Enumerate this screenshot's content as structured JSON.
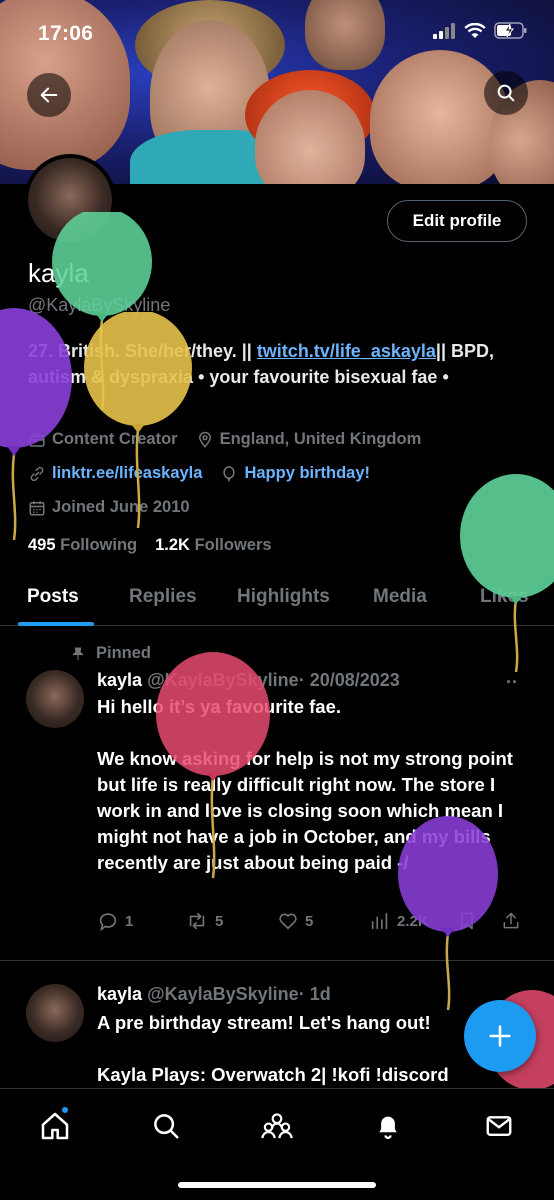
{
  "status": {
    "time": "17:06"
  },
  "profile": {
    "display_name": "kayla",
    "handle": "@KaylaBySkyline",
    "edit_label": "Edit profile",
    "bio_text": "27. British. She/her/they. || ",
    "bio_link": "twitch.tv/life_askayla",
    "bio_rest": "|| BPD, autism & dyspraxia • your favourite bisexual fae •",
    "category": "Content Creator",
    "location": "England, United Kingdom",
    "website": "linktr.ee/lifeaskayla",
    "birthday": "Happy birthday!",
    "joined": "Joined June 2010",
    "following_count": "495",
    "following_label": "Following",
    "followers_count": "1.2K",
    "followers_label": "Followers"
  },
  "tabs": [
    {
      "label": "Posts",
      "active": true
    },
    {
      "label": "Replies"
    },
    {
      "label": "Highlights"
    },
    {
      "label": "Media"
    },
    {
      "label": "Likes"
    }
  ],
  "tweets": [
    {
      "pinned_label": "Pinned",
      "name": "kayla",
      "handle": "@KaylaBySkyline",
      "date": "· 20/08/2023",
      "more": "··",
      "text": "Hi hello it’s ya favourite fae.\n\nWe know asking for help is not my strong point but life is really difficult right now. The store I work in and love is closing soon which mean I might not have a job in October, and my bills recently are just about being paid -/",
      "replies": "1",
      "reposts": "5",
      "likes": "5",
      "views": "2.2K"
    },
    {
      "name": "kayla",
      "handle": "@KaylaBySkyline",
      "date": "· 1d",
      "text": "A pre birthday stream! Let's hang out!\n\nKayla Plays: Overwatch 2| !kofi !discord"
    }
  ],
  "colors": {
    "accent": "#1d9bf0",
    "link": "#6cb4ff",
    "muted": "#71767b"
  }
}
